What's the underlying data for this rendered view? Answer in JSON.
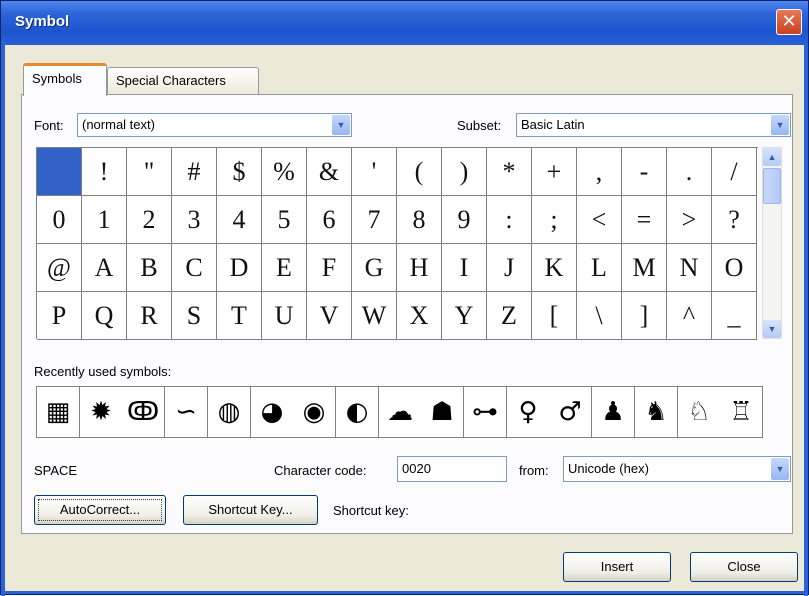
{
  "window": {
    "title": "Symbol",
    "close_glyph": "✕"
  },
  "tabs": [
    {
      "label": "Symbols",
      "active": true
    },
    {
      "label": "Special Characters",
      "active": false
    }
  ],
  "font": {
    "label": "Font:",
    "value": "(normal text)"
  },
  "subset": {
    "label": "Subset:",
    "value": "Basic Latin"
  },
  "symbol_grid": {
    "rows": [
      [
        " ",
        "!",
        "\"",
        "#",
        "$",
        "%",
        "&",
        "'",
        "(",
        ")",
        "*",
        "+",
        ",",
        "-",
        ".",
        "/"
      ],
      [
        "0",
        "1",
        "2",
        "3",
        "4",
        "5",
        "6",
        "7",
        "8",
        "9",
        ":",
        ";",
        "<",
        "=",
        ">",
        "?"
      ],
      [
        "@",
        "A",
        "B",
        "C",
        "D",
        "E",
        "F",
        "G",
        "H",
        "I",
        "J",
        "K",
        "L",
        "M",
        "N",
        "O"
      ],
      [
        "P",
        "Q",
        "R",
        "S",
        "T",
        "U",
        "V",
        "W",
        "X",
        "Y",
        "Z",
        "[",
        "\\",
        "]",
        "^",
        "_"
      ]
    ],
    "selected": " "
  },
  "recent": {
    "label": "Recently used symbols:",
    "symbols": [
      "▦",
      "✹",
      "ↂ",
      "∽",
      "◍",
      "◕",
      "◉",
      "◐",
      "☁",
      "☗",
      "⊶",
      "♀",
      "♂",
      "♟",
      "♞",
      "♘",
      "♖"
    ],
    "icons": [
      "grid-window-icon",
      "sun-icon",
      "snake-icon",
      "swirl-icon",
      "globe-americas-icon",
      "globe-europe-icon",
      "globe-asia-icon",
      "globe-grid-icon",
      "bird-icon",
      "cloud-icon",
      "key-icon",
      "woman-icon",
      "man-icon",
      "figure-icon",
      "skier-icon",
      "runner-icon",
      "hammer-icon"
    ]
  },
  "character_name": "SPACE",
  "character_code": {
    "label": "Character code:",
    "value": "0020"
  },
  "from": {
    "label": "from:",
    "value": "Unicode (hex)"
  },
  "buttons": {
    "autocorrect": "AutoCorrect...",
    "shortcut_key": "Shortcut Key...",
    "shortcut_key_label": "Shortcut key:",
    "insert": "Insert",
    "close": "Close"
  },
  "colors": {
    "title_bar": "#2b63d8",
    "selected_cell": "#3162c8",
    "tab_accent": "#e68b2c",
    "close_button": "#d9542f"
  }
}
